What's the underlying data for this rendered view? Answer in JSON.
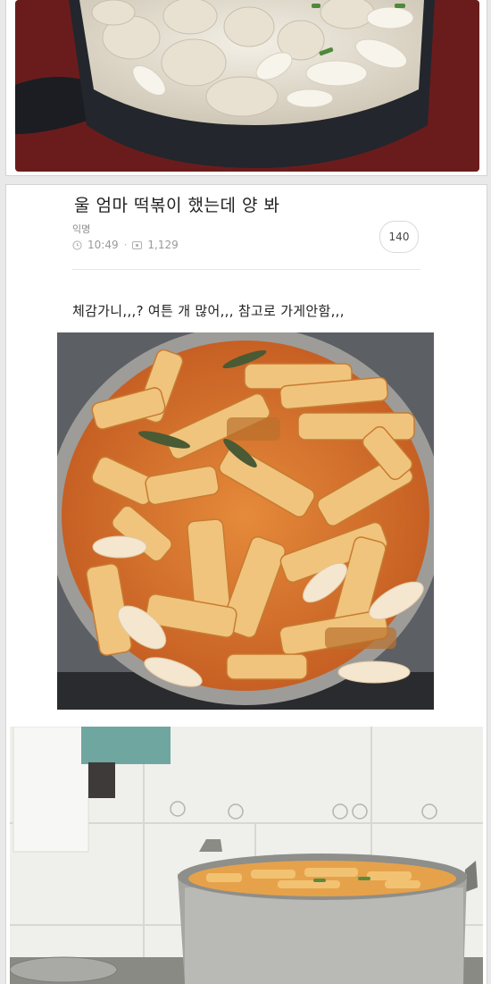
{
  "post": {
    "title": "울 엄마 떡볶이 했는데 양 봐",
    "author": "익명",
    "time": "10:49",
    "views": "1,129",
    "comment_count": "140",
    "body": "체감가니,,,? 여튼 개 많어,,, 참고로 가게안함,,,"
  },
  "colors": {
    "sauce": "#d9742c",
    "rice_cake": "#eec27a",
    "pot_steel": "#a8a8a4",
    "tile": "#efefeb"
  },
  "icons": [
    "clock-icon",
    "eye-icon"
  ]
}
